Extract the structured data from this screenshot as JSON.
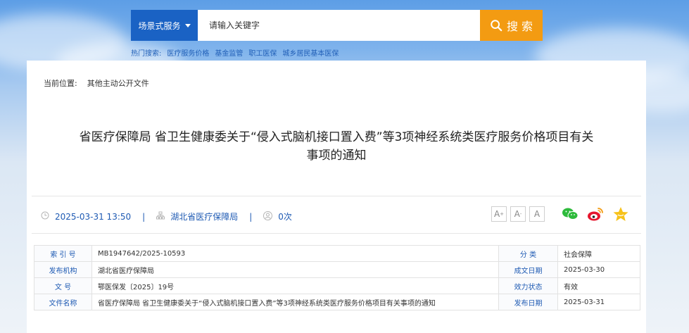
{
  "header": {
    "scene_label": "场景式服务",
    "search_placeholder": "请输入关键字",
    "search_button": "搜 索",
    "hot_label": "热门搜索:",
    "hot_items": [
      "医疗服务价格",
      "基金监管",
      "职工医保",
      "城乡居民基本医保"
    ]
  },
  "breadcrumb": {
    "label": "当前位置:",
    "current": "其他主动公开文件"
  },
  "article": {
    "title_line1": "省医疗保障局 省卫生健康委关于“侵入式脑机接口置入费”等3项神经系统类医疗服务价格项目有关",
    "title_line2": "事项的通知",
    "date": "2025-03-31 13:50",
    "publisher": "湖北省医疗保障局",
    "views": "0次",
    "separator": "|"
  },
  "font_buttons": [
    "A",
    "A",
    "A"
  ],
  "share_icons": [
    "wechat-icon",
    "weibo-icon",
    "favorite-star-icon"
  ],
  "info_table": {
    "index_label": "索 引 号",
    "index_value": "MB1947642/2025-10593",
    "category_label": "分 类",
    "category_value": "社会保障",
    "org_label": "发布机构",
    "org_value": "湖北省医疗保障局",
    "created_label": "成文日期",
    "created_value": "2025-03-30",
    "docno_label": "文 号",
    "docno_value": "鄂医保发〔2025〕19号",
    "status_label": "效力状态",
    "status_value": "有效",
    "name_label": "文件名称",
    "name_value": "省医疗保障局 省卫生健康委关于“侵入式脑机接口置入费”等3项神经系统类医疗服务价格项目有关事项的通知",
    "pubdate_label": "发布日期",
    "pubdate_value": "2025-03-31"
  },
  "colors": {
    "primary_blue": "#1a62c4",
    "search_orange": "#f39b12",
    "link_blue": "#1e5ab3"
  }
}
